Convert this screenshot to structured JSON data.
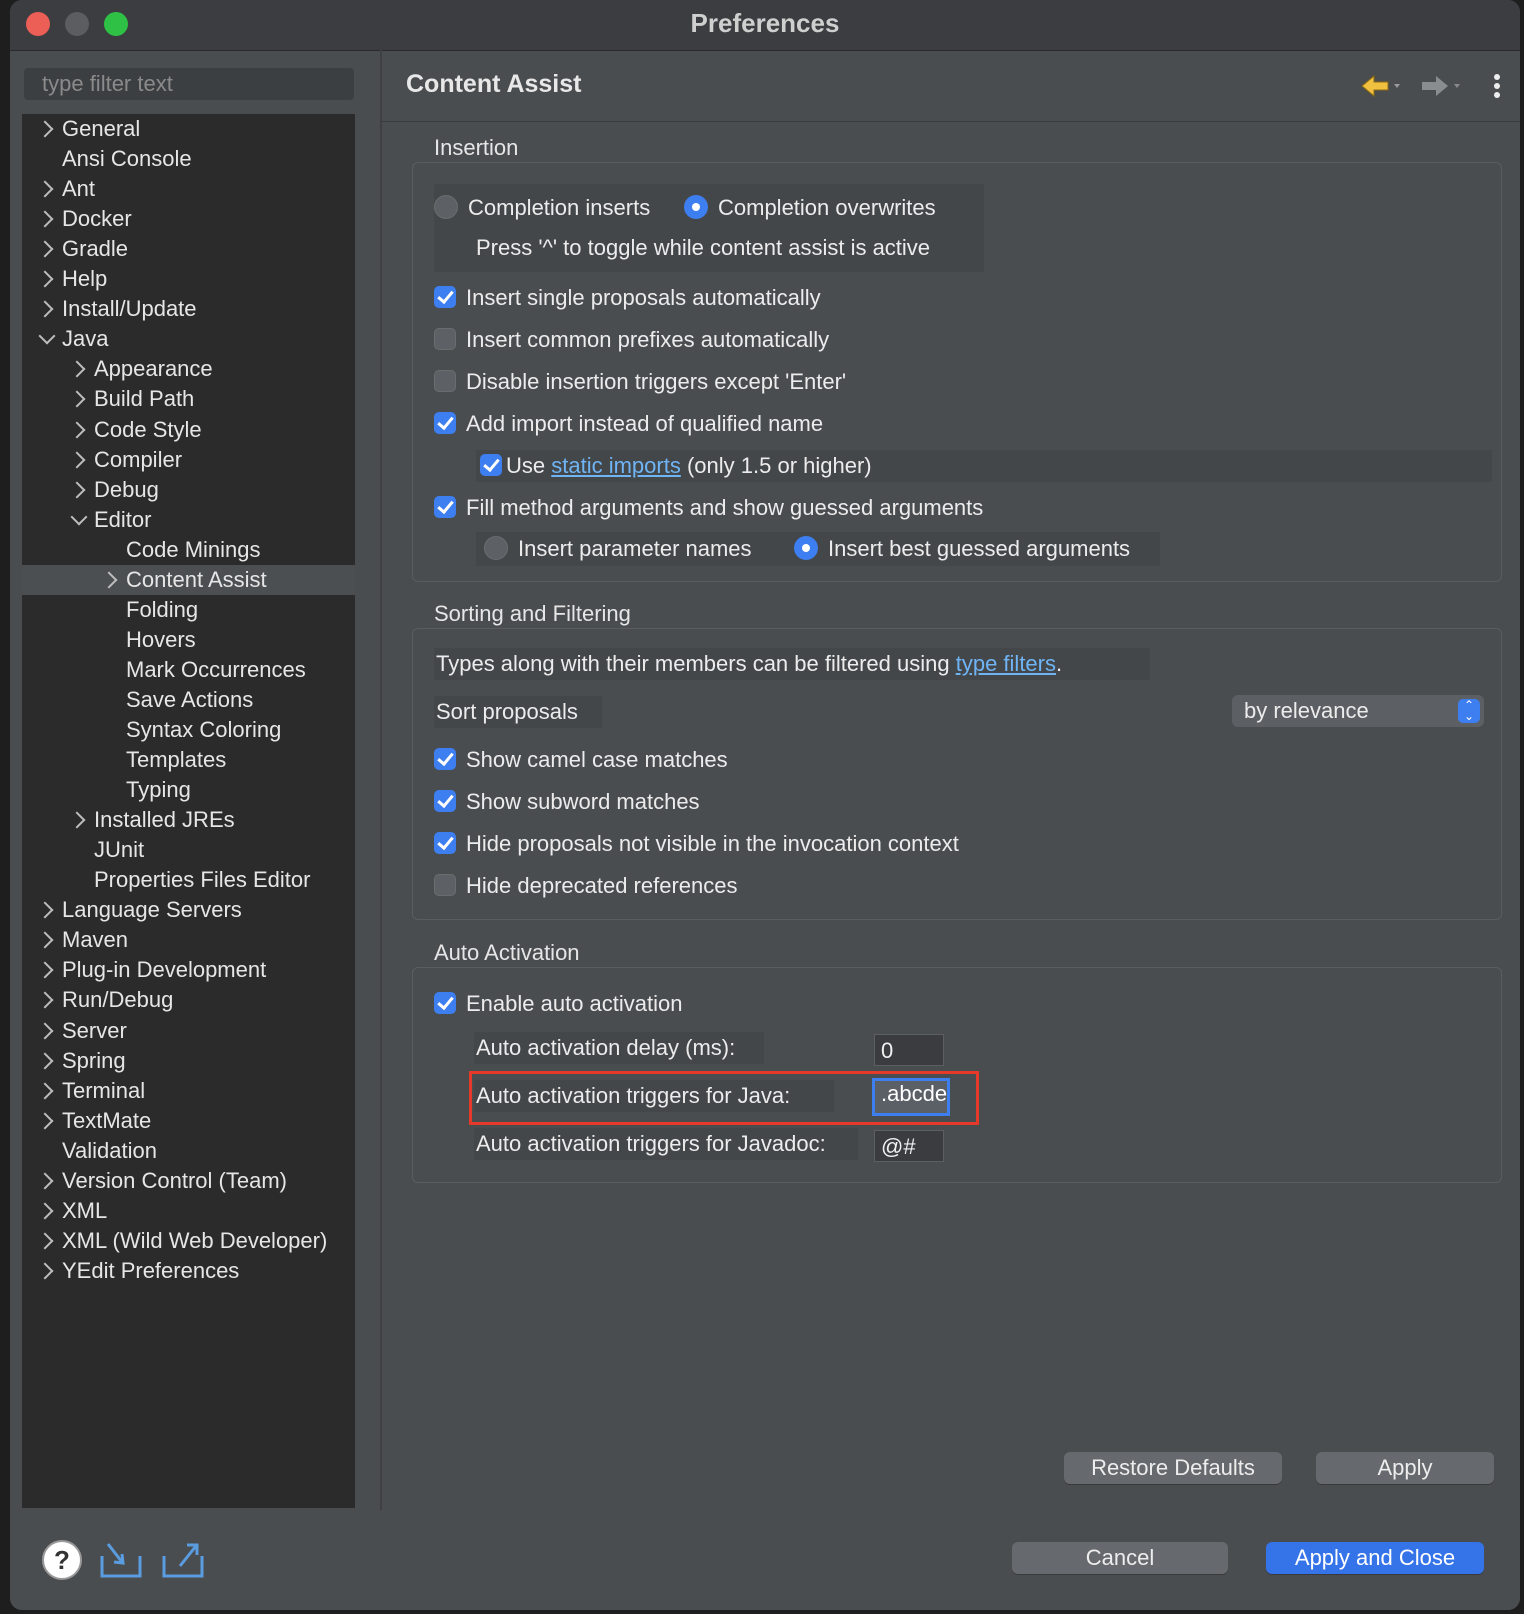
{
  "window": {
    "title": "Preferences"
  },
  "filter": {
    "placeholder": "type filter text"
  },
  "tree": [
    {
      "label": "General",
      "level": 0,
      "arrow": "right"
    },
    {
      "label": "Ansi Console",
      "level": 0,
      "arrow": "none"
    },
    {
      "label": "Ant",
      "level": 0,
      "arrow": "right"
    },
    {
      "label": "Docker",
      "level": 0,
      "arrow": "right"
    },
    {
      "label": "Gradle",
      "level": 0,
      "arrow": "right"
    },
    {
      "label": "Help",
      "level": 0,
      "arrow": "right"
    },
    {
      "label": "Install/Update",
      "level": 0,
      "arrow": "right"
    },
    {
      "label": "Java",
      "level": 0,
      "arrow": "down"
    },
    {
      "label": "Appearance",
      "level": 1,
      "arrow": "right"
    },
    {
      "label": "Build Path",
      "level": 1,
      "arrow": "right"
    },
    {
      "label": "Code Style",
      "level": 1,
      "arrow": "right"
    },
    {
      "label": "Compiler",
      "level": 1,
      "arrow": "right"
    },
    {
      "label": "Debug",
      "level": 1,
      "arrow": "right"
    },
    {
      "label": "Editor",
      "level": 1,
      "arrow": "down"
    },
    {
      "label": "Code Minings",
      "level": 2,
      "arrow": "none"
    },
    {
      "label": "Content Assist",
      "level": 2,
      "arrow": "right",
      "selected": true
    },
    {
      "label": "Folding",
      "level": 2,
      "arrow": "none"
    },
    {
      "label": "Hovers",
      "level": 2,
      "arrow": "none"
    },
    {
      "label": "Mark Occurrences",
      "level": 2,
      "arrow": "none"
    },
    {
      "label": "Save Actions",
      "level": 2,
      "arrow": "none"
    },
    {
      "label": "Syntax Coloring",
      "level": 2,
      "arrow": "none"
    },
    {
      "label": "Templates",
      "level": 2,
      "arrow": "none"
    },
    {
      "label": "Typing",
      "level": 2,
      "arrow": "none"
    },
    {
      "label": "Installed JREs",
      "level": 1,
      "arrow": "right"
    },
    {
      "label": "JUnit",
      "level": 1,
      "arrow": "none"
    },
    {
      "label": "Properties Files Editor",
      "level": 1,
      "arrow": "none"
    },
    {
      "label": "Language Servers",
      "level": 0,
      "arrow": "right"
    },
    {
      "label": "Maven",
      "level": 0,
      "arrow": "right"
    },
    {
      "label": "Plug-in Development",
      "level": 0,
      "arrow": "right"
    },
    {
      "label": "Run/Debug",
      "level": 0,
      "arrow": "right"
    },
    {
      "label": "Server",
      "level": 0,
      "arrow": "right"
    },
    {
      "label": "Spring",
      "level": 0,
      "arrow": "right"
    },
    {
      "label": "Terminal",
      "level": 0,
      "arrow": "right"
    },
    {
      "label": "TextMate",
      "level": 0,
      "arrow": "right"
    },
    {
      "label": "Validation",
      "level": 0,
      "arrow": "none"
    },
    {
      "label": "Version Control (Team)",
      "level": 0,
      "arrow": "right"
    },
    {
      "label": "XML",
      "level": 0,
      "arrow": "right"
    },
    {
      "label": "XML (Wild Web Developer)",
      "level": 0,
      "arrow": "right"
    },
    {
      "label": "YEdit Preferences",
      "level": 0,
      "arrow": "right"
    }
  ],
  "page": {
    "title": "Content Assist"
  },
  "insertion": {
    "label": "Insertion",
    "completion_inserts": "Completion inserts",
    "completion_overwrites": "Completion overwrites",
    "toggle_hint": "Press '^' to toggle while content assist is active",
    "single_proposals": "Insert single proposals automatically",
    "common_prefixes": "Insert common prefixes automatically",
    "disable_triggers": "Disable insertion triggers except 'Enter'",
    "add_import": "Add import instead of qualified name",
    "use": "Use",
    "static_imports": "static imports",
    "only_15": "(only 1.5 or higher)",
    "fill_args": "Fill method arguments and show guessed arguments",
    "param_names": "Insert parameter names",
    "best_guessed": "Insert best guessed arguments"
  },
  "sorting": {
    "label": "Sorting and Filtering",
    "types_prefix": "Types along with their members can be filtered using",
    "type_filters": "type filters",
    "types_suffix": ".",
    "sort_label": "Sort proposals",
    "sort_value": "by relevance",
    "camel_case": "Show camel case matches",
    "subword": "Show subword matches",
    "hide_not_visible": "Hide proposals not visible in the invocation context",
    "hide_deprecated": "Hide deprecated references"
  },
  "auto_activation": {
    "label": "Auto Activation",
    "enable": "Enable auto activation",
    "delay_label": "Auto activation delay (ms):",
    "delay_value": "0",
    "java_label": "Auto activation triggers for Java:",
    "java_value": ".abcdefghijklmnopqrstuvwxyz",
    "javadoc_label": "Auto activation triggers for Javadoc:",
    "javadoc_value": "@#"
  },
  "buttons": {
    "restore_defaults": "Restore Defaults",
    "apply": "Apply",
    "cancel": "Cancel",
    "apply_and_close": "Apply and Close"
  },
  "colors": {
    "accent": "#3d7ff0",
    "highlight": "#e53a2a",
    "link": "#6fb4f5"
  }
}
